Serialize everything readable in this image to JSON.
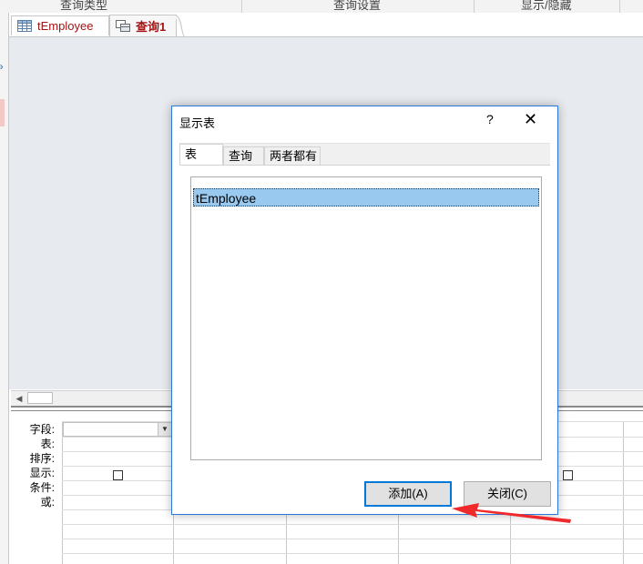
{
  "ribbon": {
    "groups": [
      "查询类型",
      "查询设置",
      "显示/隐藏"
    ]
  },
  "tabs": [
    {
      "label": "tEmployee",
      "icon": "table-icon"
    },
    {
      "label": "查询1",
      "icon": "query-icon"
    }
  ],
  "qbe": {
    "row_labels": [
      "字段:",
      "表:",
      "排序:",
      "显示:",
      "条件:",
      "或:"
    ]
  },
  "dialog": {
    "title": "显示表",
    "help": "?",
    "close": "✕",
    "tabs": [
      "表",
      "查询",
      "两者都有"
    ],
    "active_tab": "表",
    "items": [
      "tEmployee"
    ],
    "add_button": "添加(A)",
    "close_button": "关闭(C)"
  },
  "colors": {
    "selection": "#99c9ef",
    "dialog_border": "#2b79d8",
    "tab_text": "#a31515",
    "annotation_arrow": "#f02a2a"
  }
}
